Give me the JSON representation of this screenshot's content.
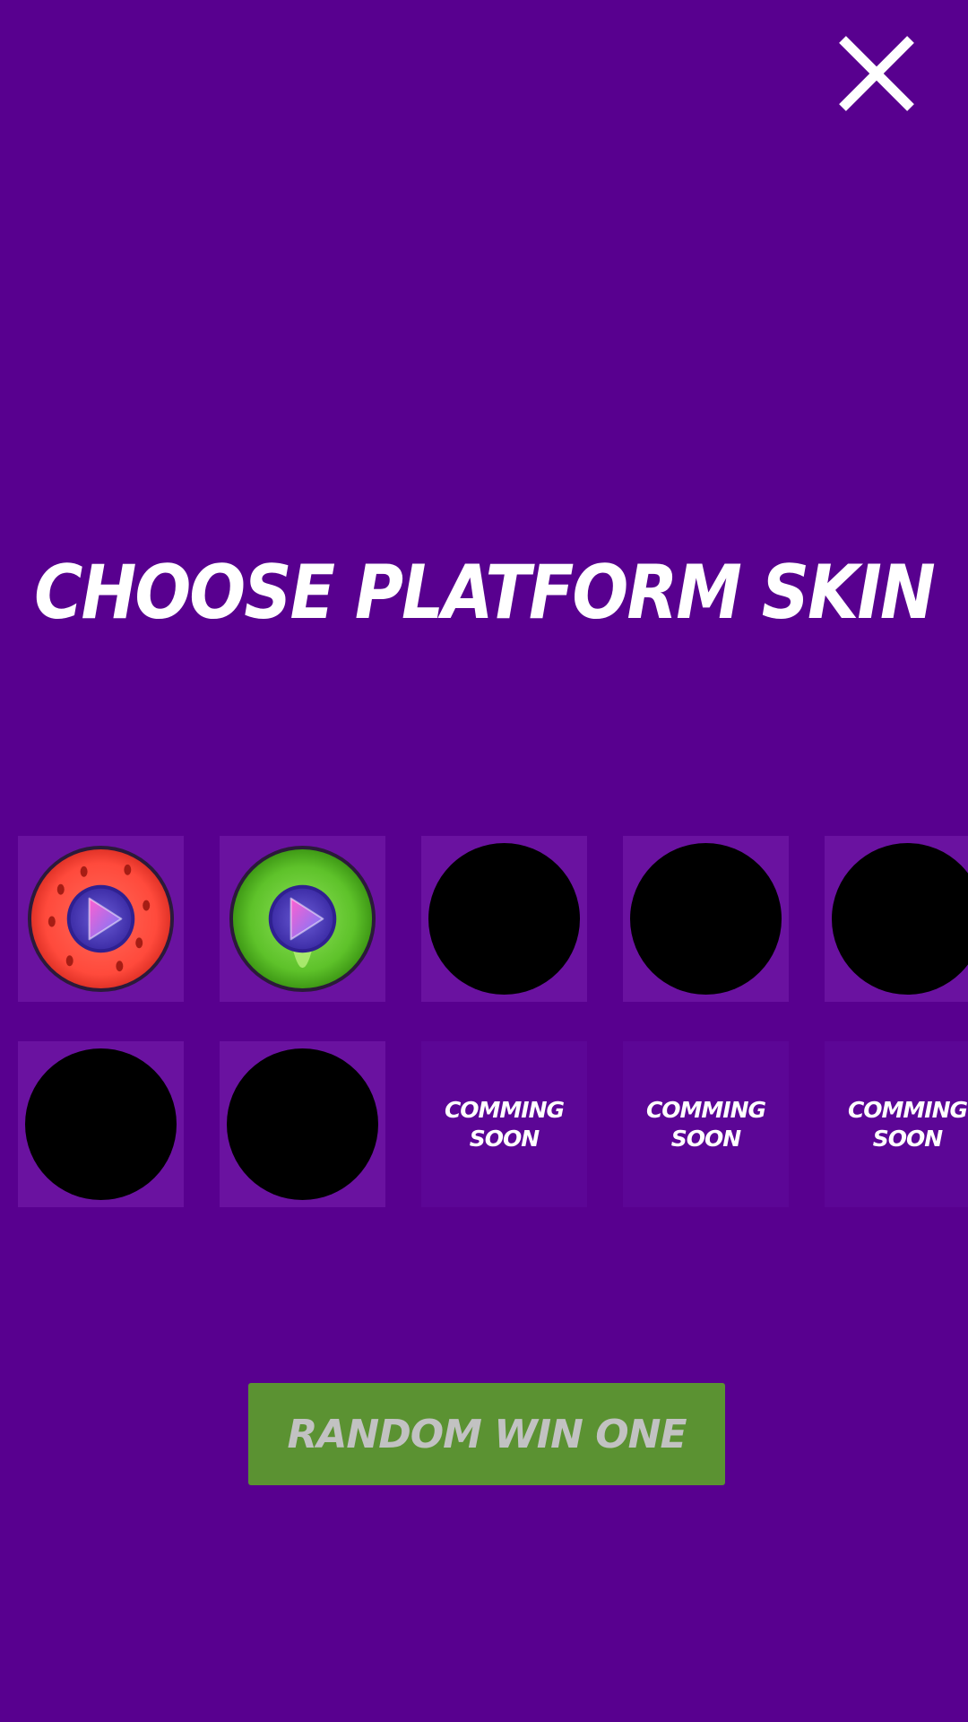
{
  "screen": {
    "title": "CHOOSE PLATFORM SKIN",
    "background_color": "#58008f"
  },
  "close_button": {
    "icon": "close-icon",
    "color": "#ffffff"
  },
  "skins": [
    {
      "state": "video-unlock",
      "skin": "watermelon",
      "icon": "play-icon"
    },
    {
      "state": "video-unlock",
      "skin": "kiwi",
      "icon": "play-icon"
    },
    {
      "state": "locked"
    },
    {
      "state": "locked"
    },
    {
      "state": "locked"
    },
    {
      "state": "locked"
    },
    {
      "state": "locked"
    },
    {
      "state": "coming-soon",
      "label": "COMMING\nSOON"
    },
    {
      "state": "coming-soon",
      "label": "COMMING\nSOON"
    },
    {
      "state": "coming-soon",
      "label": "COMMING\nSOON"
    }
  ],
  "random_button": {
    "label": "RANDOM WIN ONE",
    "background": "#5b9232",
    "text_color": "#c2c2c2"
  }
}
